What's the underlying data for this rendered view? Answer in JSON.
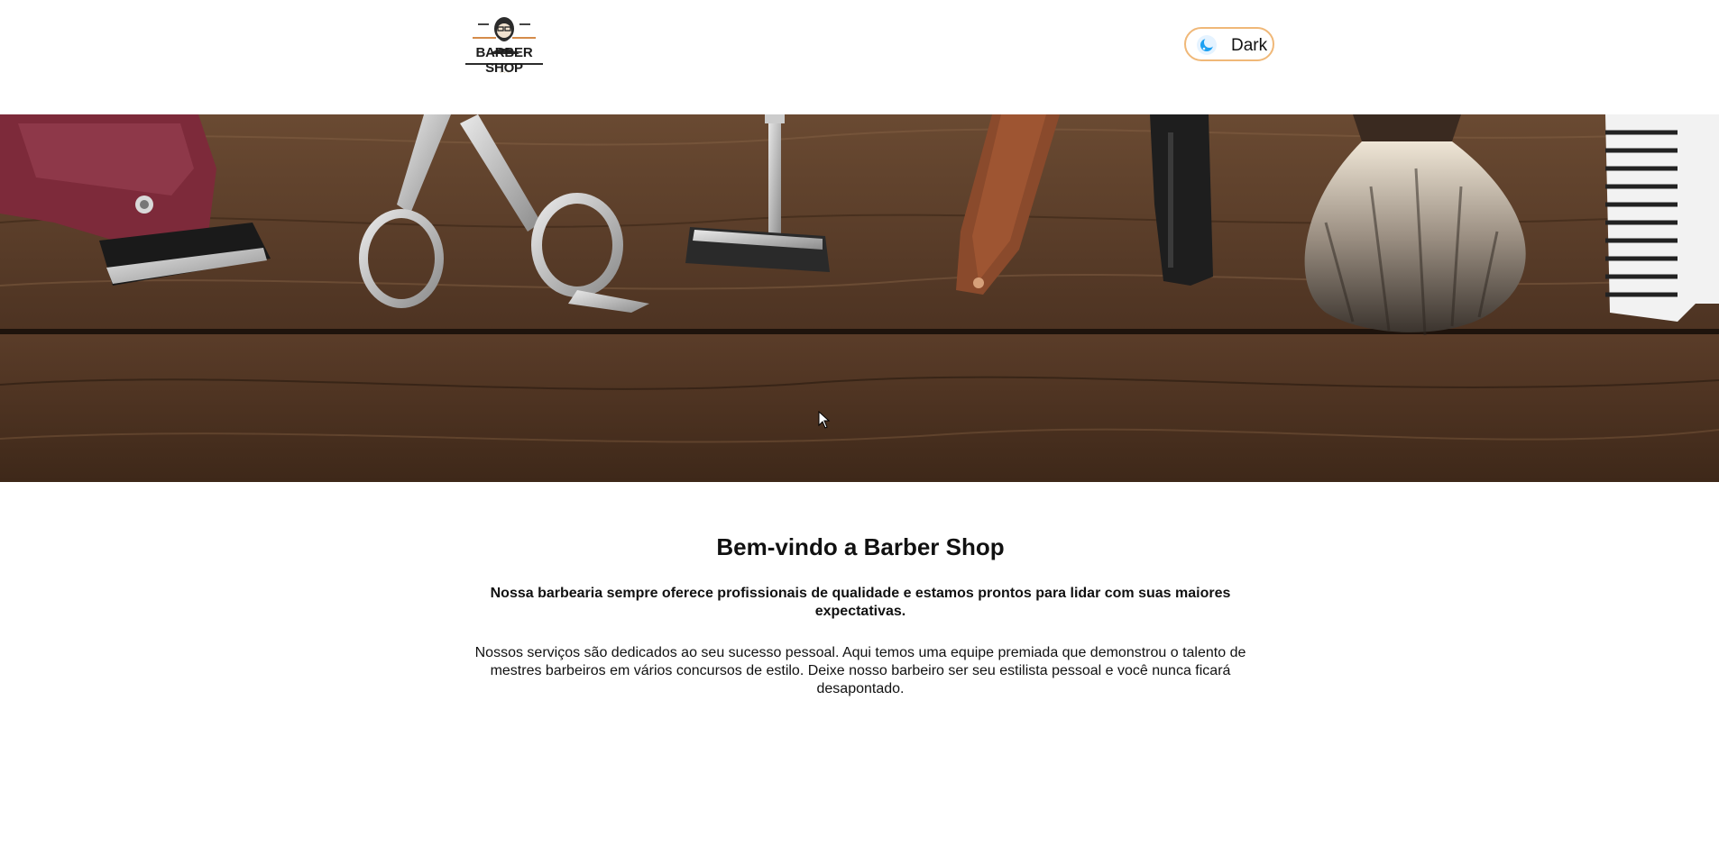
{
  "header": {
    "logo_text": "BARBER SHOP",
    "theme_toggle": {
      "label": "Dark",
      "icon": "moon-icon"
    }
  },
  "hero": {
    "image": "barber-tools-on-wood"
  },
  "main": {
    "title": "Bem-vindo a Barber Shop",
    "lead": "Nossa barbearia sempre oferece profissionais de qualidade e estamos prontos para lidar com suas maiores expectativas.",
    "body": "Nossos serviços são dedicados ao seu sucesso pessoal. Aqui temos uma equipe premiada que demonstrou o talento de mestres barbeiros em vários concursos de estilo. Deixe nosso barbeiro ser seu estilista pessoal e você nunca ficará desapontado."
  },
  "colors": {
    "toggle_border": "#f0b878",
    "wood_dark": "#3a2618",
    "wood_light": "#6b4a32",
    "text": "#111111"
  }
}
